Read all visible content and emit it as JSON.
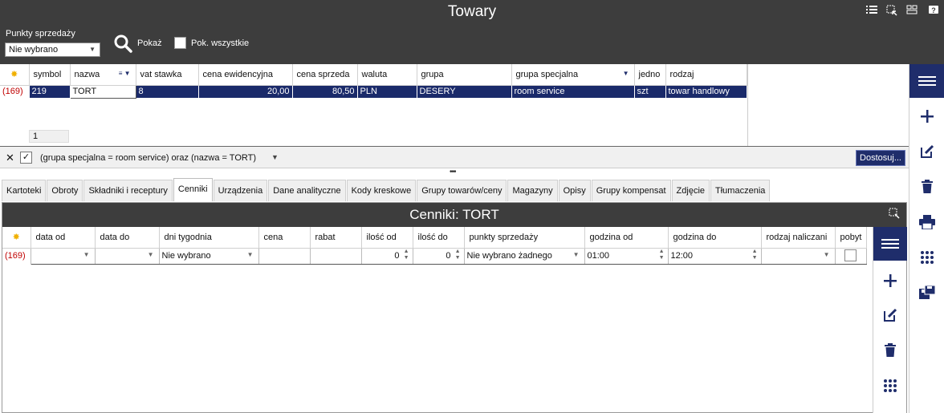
{
  "window": {
    "title": "Towary"
  },
  "toolbar": {
    "points_label": "Punkty sprzedaży",
    "points_value": "Nie wybrano",
    "show_label": "Pokaż",
    "show_all_label": "Pok. wszystkie"
  },
  "grid": {
    "columns": [
      "symbol",
      "nazwa",
      "vat stawka",
      "cena ewidencyjna",
      "cena sprzeda",
      "waluta",
      "grupa",
      "grupa specjalna",
      "jedno",
      "rodzaj"
    ],
    "row": {
      "row_number": "(169)",
      "symbol": "219",
      "nazwa": "TORT",
      "vat_stawka": "8",
      "cena_ewidencyjna": "20,00",
      "cena_sprzedazy": "80,50",
      "waluta": "PLN",
      "grupa": "DESERY",
      "grupa_specjalna": "room service",
      "jednostka": "szt",
      "rodzaj": "towar handlowy"
    },
    "count": "1"
  },
  "filter": {
    "text": "(grupa specjalna = room service) oraz (nazwa = TORT)",
    "customize_label": "Dostosuj..."
  },
  "tabs": [
    "Kartoteki",
    "Obroty",
    "Składniki i receptury",
    "Cenniki",
    "Urządzenia",
    "Dane analityczne",
    "Kody kreskowe",
    "Grupy towarów/ceny",
    "Magazyny",
    "Opisy",
    "Grupy kompensat",
    "Zdjęcie",
    "Tłumaczenia"
  ],
  "active_tab": "Cenniki",
  "price_panel": {
    "title": "Cenniki: TORT",
    "columns": [
      "data od",
      "data do",
      "dni tygodnia",
      "cena",
      "rabat",
      "ilość od",
      "ilość do",
      "punkty sprzedaży",
      "godzina od",
      "godzina do",
      "rodzaj naliczani",
      "pobyt"
    ],
    "row": {
      "row_number": "(169)",
      "data_od": "",
      "data_do": "",
      "dni_tygodnia": "Nie wybrano",
      "cena": "",
      "rabat": "",
      "ilosc_od": "0",
      "ilosc_do": "0",
      "punkty_sprzedazy": "Nie wybrano żadnego",
      "godzina_od": "01:00",
      "godzina_do": "12:00",
      "rodzaj_naliczania": ""
    }
  },
  "colors": {
    "header_dark": "#3d3d3d",
    "accent_navy": "#1f2d6b",
    "row_number_red": "#c00000"
  }
}
